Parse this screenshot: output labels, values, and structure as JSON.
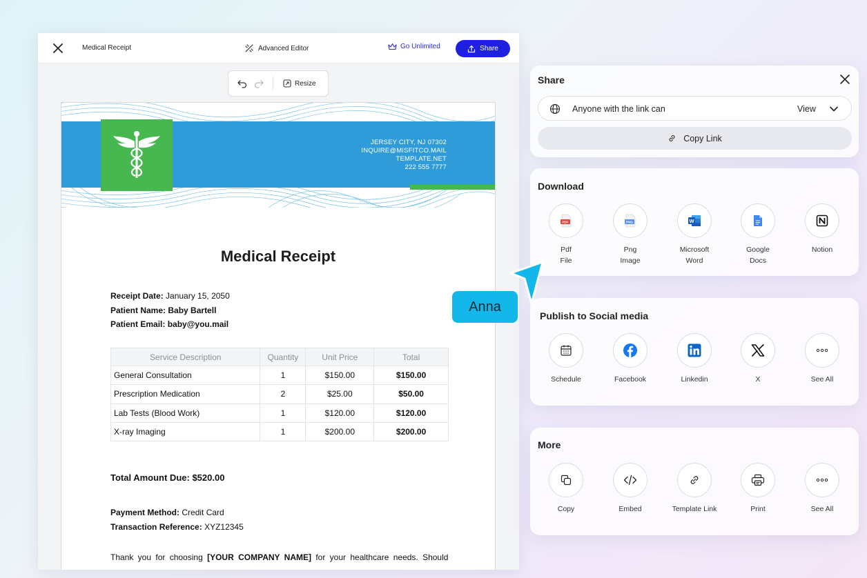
{
  "editor": {
    "doc_title": "Medical Receipt",
    "advanced_editor": "Advanced Editor",
    "go_unlimited": "Go Unlimited",
    "share": "Share",
    "resize": "Resize"
  },
  "document": {
    "contact": {
      "address": "JERSEY CITY, NJ 07302",
      "email": "INQUIRE@MISFITCO.MAIL",
      "site": "TEMPLATE.NET",
      "phone": "222 555 7777"
    },
    "title": "Medical Receipt",
    "receipt_date_label": "Receipt Date:",
    "receipt_date": "January 15, 2050",
    "patient_name_label": "Patient Name:",
    "patient_name": "Baby Bartell",
    "patient_email_label": "Patient Email:",
    "patient_email": "baby@you.mail",
    "table": {
      "headers": [
        "Service Description",
        "Quantity",
        "Unit Price",
        "Total"
      ],
      "rows": [
        [
          "General Consultation",
          "1",
          "$150.00",
          "$150.00"
        ],
        [
          "Prescription Medication",
          "2",
          "$25.00",
          "$50.00"
        ],
        [
          "Lab Tests (Blood Work)",
          "1",
          "$120.00",
          "$120.00"
        ],
        [
          "X-ray Imaging",
          "1",
          "$200.00",
          "$200.00"
        ]
      ]
    },
    "total_due_label": "Total Amount Due:",
    "total_due": "$520.00",
    "payment_method_label": "Payment Method:",
    "payment_method": "Credit Card",
    "transaction_ref_label": "Transaction Reference:",
    "transaction_ref": "XYZ12345",
    "thanks_pre": "Thank you for choosing",
    "thanks_company": "[YOUR COMPANY NAME]",
    "thanks_post": "for your healthcare needs. Should"
  },
  "share_panel": {
    "title": "Share",
    "permission_text": "Anyone with the link can",
    "permission_value": "View",
    "copy_link": "Copy Link"
  },
  "download": {
    "title": "Download",
    "items": [
      {
        "line1": "Pdf",
        "line2": "File",
        "icon": "pdf-icon"
      },
      {
        "line1": "Png",
        "line2": "Image",
        "icon": "png-icon"
      },
      {
        "line1": "Microsoft",
        "line2": "Word",
        "icon": "word-icon"
      },
      {
        "line1": "Google",
        "line2": "Docs",
        "icon": "google-docs-icon"
      },
      {
        "line1": "Notion",
        "line2": "",
        "icon": "notion-icon"
      }
    ]
  },
  "social": {
    "title": "Publish to Social media",
    "items": [
      {
        "label": "Schedule",
        "icon": "calendar-icon"
      },
      {
        "label": "Facebook",
        "icon": "facebook-icon"
      },
      {
        "label": "Linkedin",
        "icon": "linkedin-icon"
      },
      {
        "label": "X",
        "icon": "x-logo-icon"
      },
      {
        "label": "See All",
        "icon": "more-icon"
      }
    ]
  },
  "more": {
    "title": "More",
    "items": [
      {
        "label": "Copy",
        "icon": "copy-icon"
      },
      {
        "label": "Embed",
        "icon": "code-icon"
      },
      {
        "label": "Template Link",
        "icon": "link-icon"
      },
      {
        "label": "Print",
        "icon": "printer-icon"
      },
      {
        "label": "See All",
        "icon": "more-icon"
      }
    ]
  },
  "collaborator": {
    "name": "Anna",
    "color": "#14b7ea"
  },
  "colors": {
    "brand_blue": "#1f1fe0",
    "header_blue": "#2f9bd9",
    "header_green": "#46b84f"
  }
}
